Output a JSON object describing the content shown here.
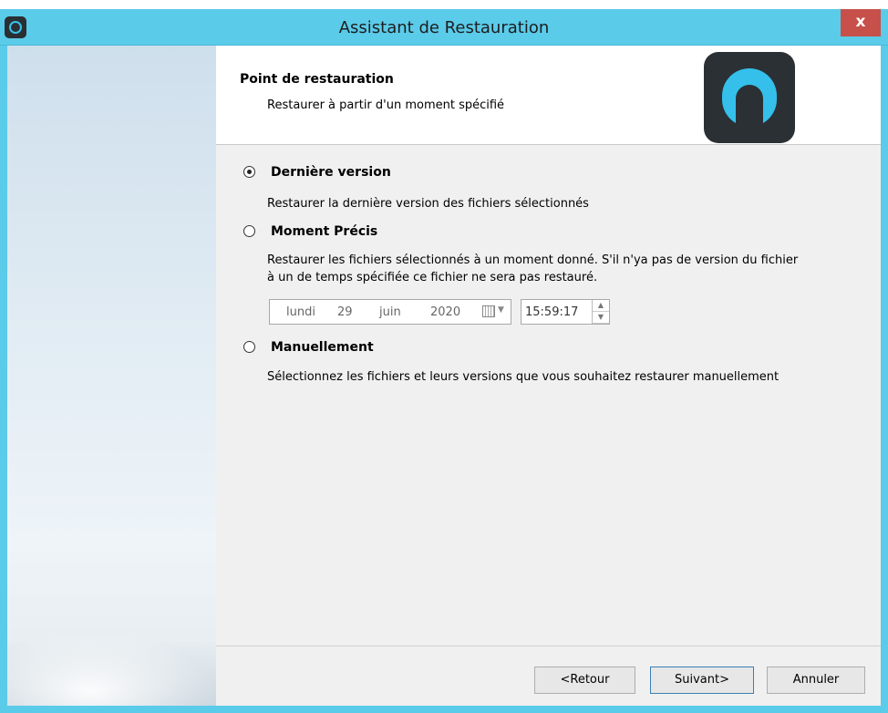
{
  "window": {
    "title": "Assistant de Restauration",
    "close_glyph": "x",
    "icon": "app-logo-icon"
  },
  "header": {
    "title": "Point de restauration",
    "subtitle": "Restaurer à partir d'un moment spécifié"
  },
  "options": [
    {
      "label": "Dernière version",
      "description": "Restaurer la dernière version des fichiers sélectionnés",
      "selected": true
    },
    {
      "label": "Moment Précis",
      "description_line1": "Restaurer les fichiers sélectionnés à un moment donné. S'il n'ya pas de version du fichier",
      "description_line2": "à un de temps spécifiée ce fichier ne sera pas restauré.",
      "selected": false
    },
    {
      "label": "Manuellement",
      "description": "Sélectionnez les fichiers et leurs versions que vous souhaitez restaurer manuellement",
      "selected": false
    }
  ],
  "date": {
    "weekday": "lundi",
    "day": "29",
    "month": "juin",
    "year": "2020"
  },
  "time": {
    "value": "15:59:17"
  },
  "buttons": {
    "back": "<Retour",
    "next": "Suivant>",
    "cancel": "Annuler"
  },
  "colors": {
    "titlebar": "#5bcbea",
    "close": "#c7504a",
    "accent": "#34c0ea"
  }
}
